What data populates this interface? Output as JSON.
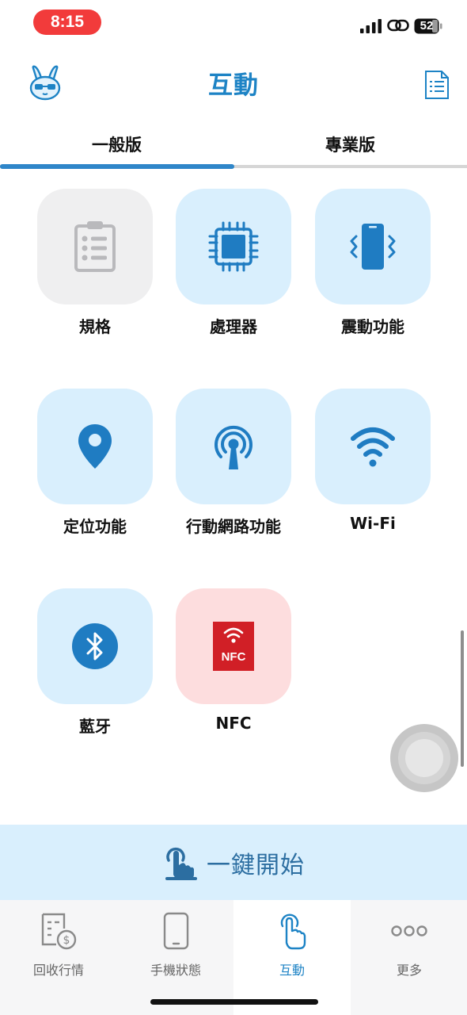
{
  "status_bar": {
    "time": "8:15",
    "battery": "52"
  },
  "header": {
    "title": "互動"
  },
  "tabs": [
    {
      "label": "一般版",
      "selected": true
    },
    {
      "label": "專業版",
      "selected": false
    }
  ],
  "features": [
    {
      "label": "規格",
      "icon": "clipboard-list-icon"
    },
    {
      "label": "處理器",
      "icon": "cpu-chip-icon"
    },
    {
      "label": "震動功能",
      "icon": "vibrating-phone-icon"
    },
    {
      "label": "定位功能",
      "icon": "location-pin-icon"
    },
    {
      "label": "行動網路功能",
      "icon": "cellular-antenna-icon"
    },
    {
      "label": "Wi-Fi",
      "icon": "wifi-icon"
    },
    {
      "label": "藍牙",
      "icon": "bluetooth-icon"
    },
    {
      "label": "NFC",
      "icon": "nfc-icon",
      "icon_text": "NFC"
    }
  ],
  "start_button": {
    "label": "一鍵開始"
  },
  "bottom_nav": [
    {
      "label": "回收行情",
      "icon": "price-list-icon",
      "active": false
    },
    {
      "label": "手機狀態",
      "icon": "phone-icon",
      "active": false
    },
    {
      "label": "互動",
      "icon": "tap-hand-icon",
      "active": true
    },
    {
      "label": "更多",
      "icon": "more-dots-icon",
      "active": false
    }
  ],
  "colors": {
    "accent": "#1d83c5",
    "tile_blue": "#d9effd",
    "tile_gray": "#efeff0",
    "tile_pink": "#fdddde",
    "nfc_red": "#d11f26",
    "time_pill": "#f23b3b"
  }
}
